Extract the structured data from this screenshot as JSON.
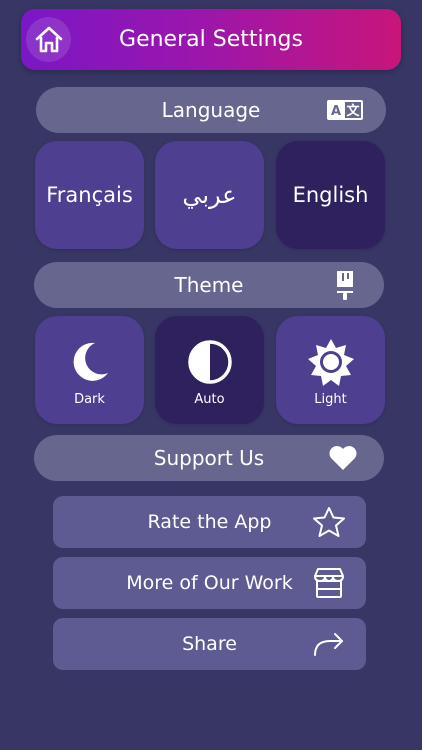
{
  "header": {
    "title": "General Settings"
  },
  "language": {
    "label": "Language",
    "options": [
      {
        "label": "Français"
      },
      {
        "label": "عربي"
      },
      {
        "label": "English"
      }
    ],
    "selected": "English"
  },
  "theme": {
    "label": "Theme",
    "options": [
      {
        "label": "Dark"
      },
      {
        "label": "Auto"
      },
      {
        "label": "Light"
      }
    ],
    "selected": "Auto"
  },
  "support": {
    "label": "Support Us",
    "items": [
      {
        "label": "Rate the App"
      },
      {
        "label": "More of Our Work"
      },
      {
        "label": "Share"
      }
    ]
  },
  "colors": {
    "background": "#373665",
    "header_gradient_start": "#7a17c6",
    "header_gradient_end": "#c8157a",
    "pill": "#67668f",
    "tile": "#4e3f90",
    "tile_selected": "#2e215e",
    "row_button": "#5e5b92"
  },
  "icons": {
    "home": "home-icon",
    "language": "translate-icon",
    "theme": "paint-brush-icon",
    "dark": "moon-icon",
    "auto": "half-circle-icon",
    "light": "sun-icon",
    "support": "heart-icon",
    "rate": "star-icon",
    "more": "store-icon",
    "share": "share-arrow-icon"
  }
}
